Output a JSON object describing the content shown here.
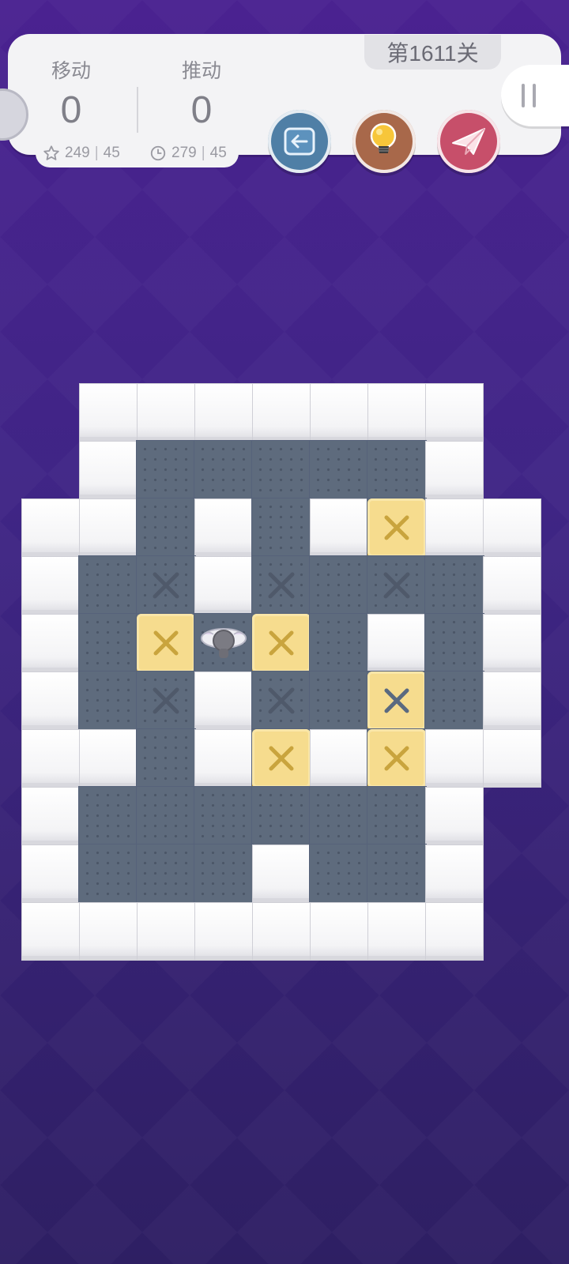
{
  "hud": {
    "level": "第1611关",
    "moves_label": "移动",
    "moves_value": "0",
    "pushes_label": "推动",
    "pushes_value": "0",
    "star_best": "249",
    "star_target": "45",
    "time_best": "279",
    "time_target": "45",
    "separator": "|"
  },
  "buttons": {
    "undo": "undo-arrow-icon",
    "hint": "lightbulb-icon",
    "share": "paper-plane-icon",
    "pause": "pause-icon"
  },
  "colors": {
    "background": "#45228a",
    "floor": "#5e6b7d",
    "wall": "#f4f4f6",
    "box": "#f6dc8e",
    "undo_button": "#4f7fa6",
    "hint_button": "#a8684a",
    "share_button": "#c74f6a"
  },
  "board": {
    "legend": {
      "W": "wall",
      "F": "floor",
      "G": "goal",
      "B": "box",
      "D": "box-on-goal",
      "P": "player",
      ".": "empty"
    },
    "rows": [
      ".WWWWWWW.",
      ".WFFFFFW.",
      "WWFWFWBWW",
      "WFGWGFGFW",
      "WFBPBFWFW",
      "WFGWGFDFW",
      "WWFWBWBWW",
      "WFFFFFFW.",
      "WFFFWFFW.",
      "WWWWWWWW."
    ]
  }
}
